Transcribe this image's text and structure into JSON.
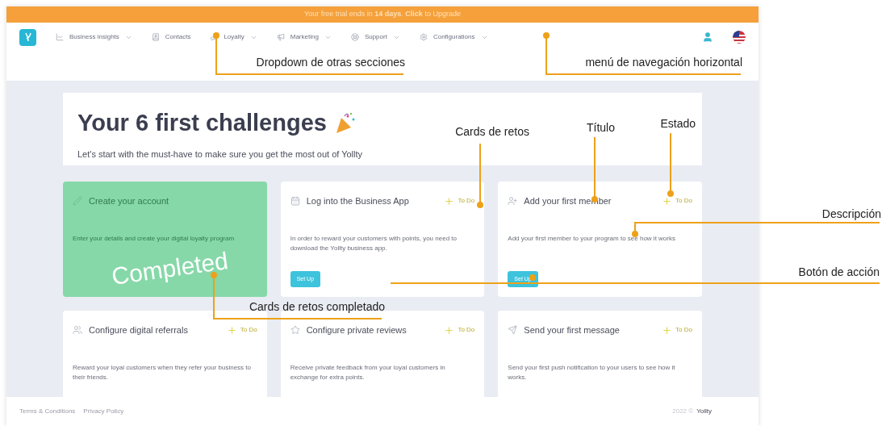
{
  "banner": {
    "text": "Your free trial ends in **14 days**. **Click** to Upgrade"
  },
  "nav": {
    "items": [
      {
        "label": "Business insights",
        "has_dropdown": true
      },
      {
        "label": "Contacts",
        "has_dropdown": false
      },
      {
        "label": "Loyalty",
        "has_dropdown": true
      },
      {
        "label": "Marketing",
        "has_dropdown": true
      },
      {
        "label": "Support",
        "has_dropdown": true
      },
      {
        "label": "Configurations",
        "has_dropdown": true
      }
    ]
  },
  "header": {
    "title": "Your 6 first challenges",
    "subtitle": "Let's start with the must-have to make sure you get the most out of Yollty"
  },
  "challenges": [
    {
      "title": "Create your account",
      "description": "Enter your details and create your digital loyalty program",
      "completed": true,
      "stamp": "Completed"
    },
    {
      "title": "Log into the Business App",
      "description": "In order to reward your customers with points, you need to download the Yollty business app.",
      "completed": false,
      "status": "To Do",
      "button": "Set Up"
    },
    {
      "title": "Add your first member",
      "description": "Add your first member to your program to see how it works",
      "completed": false,
      "status": "To Do",
      "button": "Set Up"
    },
    {
      "title": "Configure digital referrals",
      "description": "Reward your loyal customers when they refer your business to their friends.",
      "completed": false,
      "status": "To Do"
    },
    {
      "title": "Configure private reviews",
      "description": "Receive private feedback from your loyal customers in exchange for extra points.",
      "completed": false,
      "status": "To Do"
    },
    {
      "title": "Send your first message",
      "description": "Send your first push notification to your users to see how it works.",
      "completed": false,
      "status": "To Do"
    }
  ],
  "footer": {
    "links": [
      "Terms & Conditions",
      "Privacy Policy"
    ],
    "copyright": "2022 ©",
    "brand": "Yollty"
  },
  "annotations": [
    {
      "text": "Dropdown de otras secciones"
    },
    {
      "text": "menú de navegación horizontal"
    },
    {
      "text": "Cards de retos"
    },
    {
      "text": "Título"
    },
    {
      "text": "Estado"
    },
    {
      "text": "Descripción"
    },
    {
      "text": "Botón de acción"
    },
    {
      "text": "Cards de retos completado"
    }
  ]
}
